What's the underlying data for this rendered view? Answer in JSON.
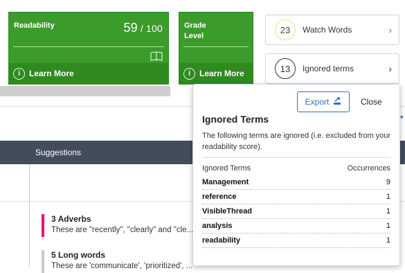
{
  "readability_card": {
    "title": "Readability",
    "score": "59",
    "denominator": "/ 100",
    "learn_more": "Learn More",
    "info_glyph": "i"
  },
  "grade_card": {
    "title_line1": "Grade",
    "title_line2": "Level",
    "learn_more": "Learn More",
    "info_glyph": "i"
  },
  "watch_words": {
    "count": "23",
    "label": "Watch Words",
    "chevron": "›"
  },
  "ignored_terms_card": {
    "count": "13",
    "label": "Ignored terms",
    "chevron": "›"
  },
  "table_header": {
    "suggestions": "Suggestions"
  },
  "suggestions": [
    {
      "title": "3 Adverbs",
      "desc": "These are \"recently\", \"clearly\" and \"cle...",
      "color": "#e5157a"
    },
    {
      "title": "5 Long words",
      "desc": "These are 'communicate', 'prioritized', ...",
      "color": "#c9c9c9"
    }
  ],
  "popover": {
    "export_label": "Export",
    "close_label": "Close",
    "title": "Ignored Terms",
    "description": "The following terms are ignored (i.e. excluded from your readability score).",
    "col_terms": "Ignored Terms",
    "col_occurrences": "Occurrences",
    "rows": [
      {
        "term": "Management",
        "occurrences": "9"
      },
      {
        "term": "reference",
        "occurrences": "1"
      },
      {
        "term": "VisibleThread",
        "occurrences": "1"
      },
      {
        "term": "analysis",
        "occurrences": "1"
      },
      {
        "term": "readability",
        "occurrences": "1"
      }
    ]
  },
  "colors": {
    "green": "#3b9b2b",
    "green_dark": "#2f8a20",
    "header_dark": "#424c5a",
    "link_blue": "#2f6fc2",
    "watch_ring": "#f2e36b",
    "adverb_accent": "#e5157a"
  },
  "icons": {
    "book": "book-icon",
    "info": "info-icon",
    "export": "export-icon",
    "chevron": "chevron-right-icon"
  }
}
